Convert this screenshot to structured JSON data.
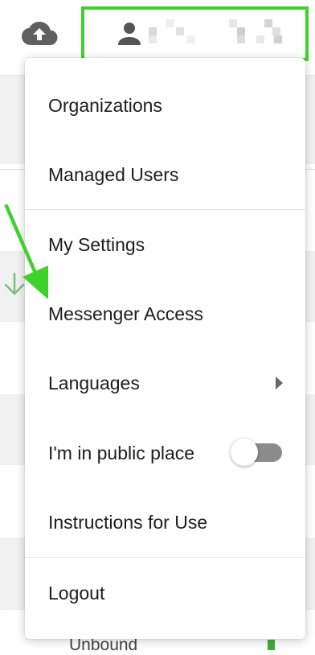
{
  "menu": {
    "items": [
      {
        "label": "Organizations"
      },
      {
        "label": "Managed Users"
      },
      {
        "label": "My Settings"
      },
      {
        "label": "Messenger Access"
      },
      {
        "label": "Languages"
      },
      {
        "label": "I'm in public place",
        "toggle": false
      },
      {
        "label": "Instructions for Use"
      },
      {
        "label": "Logout"
      }
    ]
  },
  "background": {
    "status_text": "Unbound"
  },
  "colors": {
    "highlight": "#3fd12b",
    "toggle_off": "#8c8c8c"
  },
  "icons": [
    "cloud-upload-icon",
    "person-icon",
    "sort-down-icon",
    "chevron-right-icon",
    "annotation-arrow"
  ]
}
